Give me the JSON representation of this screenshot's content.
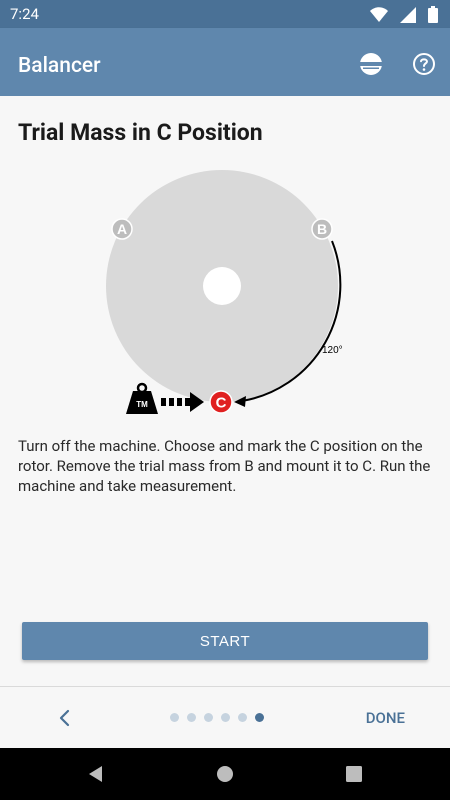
{
  "status_bar": {
    "time": "7:24",
    "icons": [
      "wifi-icon",
      "signal-icon",
      "battery-icon"
    ]
  },
  "app_bar": {
    "title": "Balancer",
    "actions": [
      "balance-icon",
      "help-icon"
    ]
  },
  "page": {
    "title": "Trial Mass in C Position"
  },
  "diagram": {
    "labels": {
      "a": "A",
      "b": "B",
      "c": "C",
      "angle": "120°",
      "trial_mass": "TM"
    }
  },
  "instructions": "Turn off the machine. Choose and mark the C position on the rotor. Remove the trial mass from B and mount it to C. Run the machine and take measurement.",
  "start_button": {
    "label": "START"
  },
  "bottom_nav": {
    "done_label": "DONE",
    "page_count": 6,
    "current_page": 6
  },
  "colors": {
    "primary": "#5f87ad",
    "status_bar": "#4a7196",
    "rotor": "#d9d9d9",
    "marker_c": "#e02020"
  }
}
